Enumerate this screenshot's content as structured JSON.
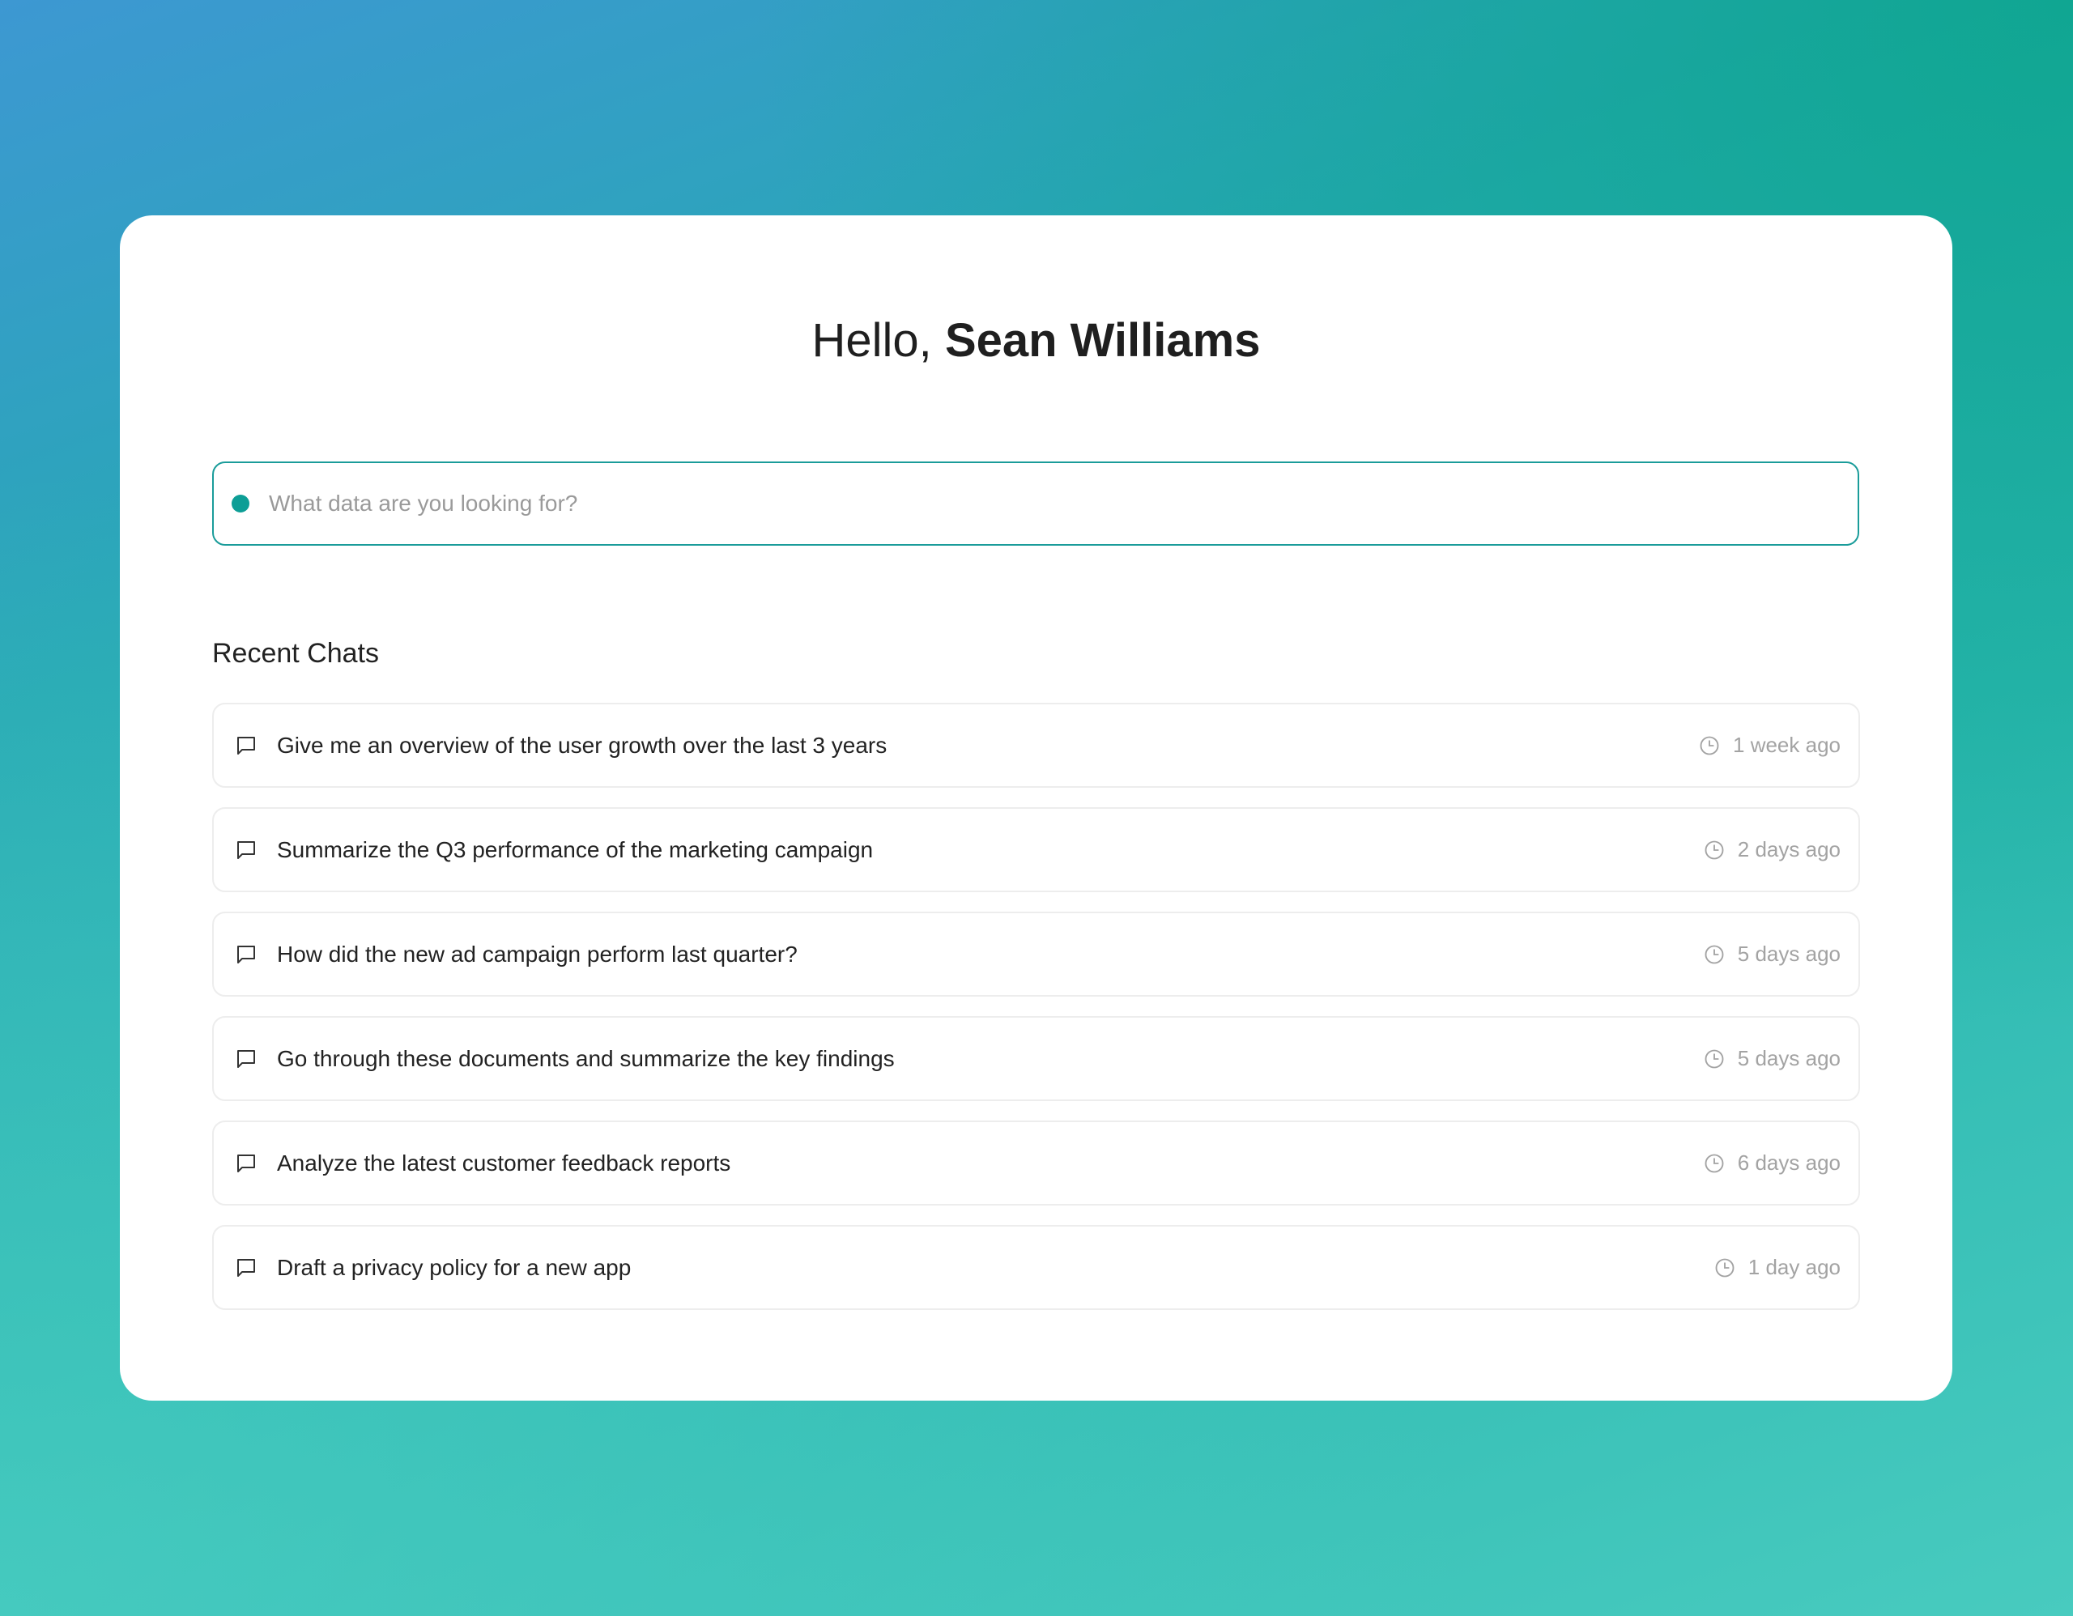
{
  "greeting": {
    "hello": "Hello,",
    "name": "Sean Williams"
  },
  "search": {
    "placeholder": "What data are you looking for?",
    "value": "",
    "indicator_color": "#0d9e96"
  },
  "recent": {
    "title": "Recent Chats",
    "chats": [
      {
        "text": "Give me an overview of the user growth over the last 3 years",
        "time": "1 week ago"
      },
      {
        "text": "Summarize the Q3 performance of the marketing campaign",
        "time": "2 days ago"
      },
      {
        "text": "How did the new ad campaign perform last quarter?",
        "time": "5 days ago"
      },
      {
        "text": "Go through these documents and summarize the key findings",
        "time": "5 days ago"
      },
      {
        "text": "Analyze the latest customer feedback reports",
        "time": "6 days ago"
      },
      {
        "text": "Draft a privacy policy for a new app",
        "time": "1 day ago"
      }
    ]
  },
  "icons": {
    "chat": "message-square-icon",
    "time": "clock-icon"
  },
  "colors": {
    "accent": "#1a9c9a",
    "card": "#ffffff",
    "muted_text": "#a3a3a3"
  }
}
